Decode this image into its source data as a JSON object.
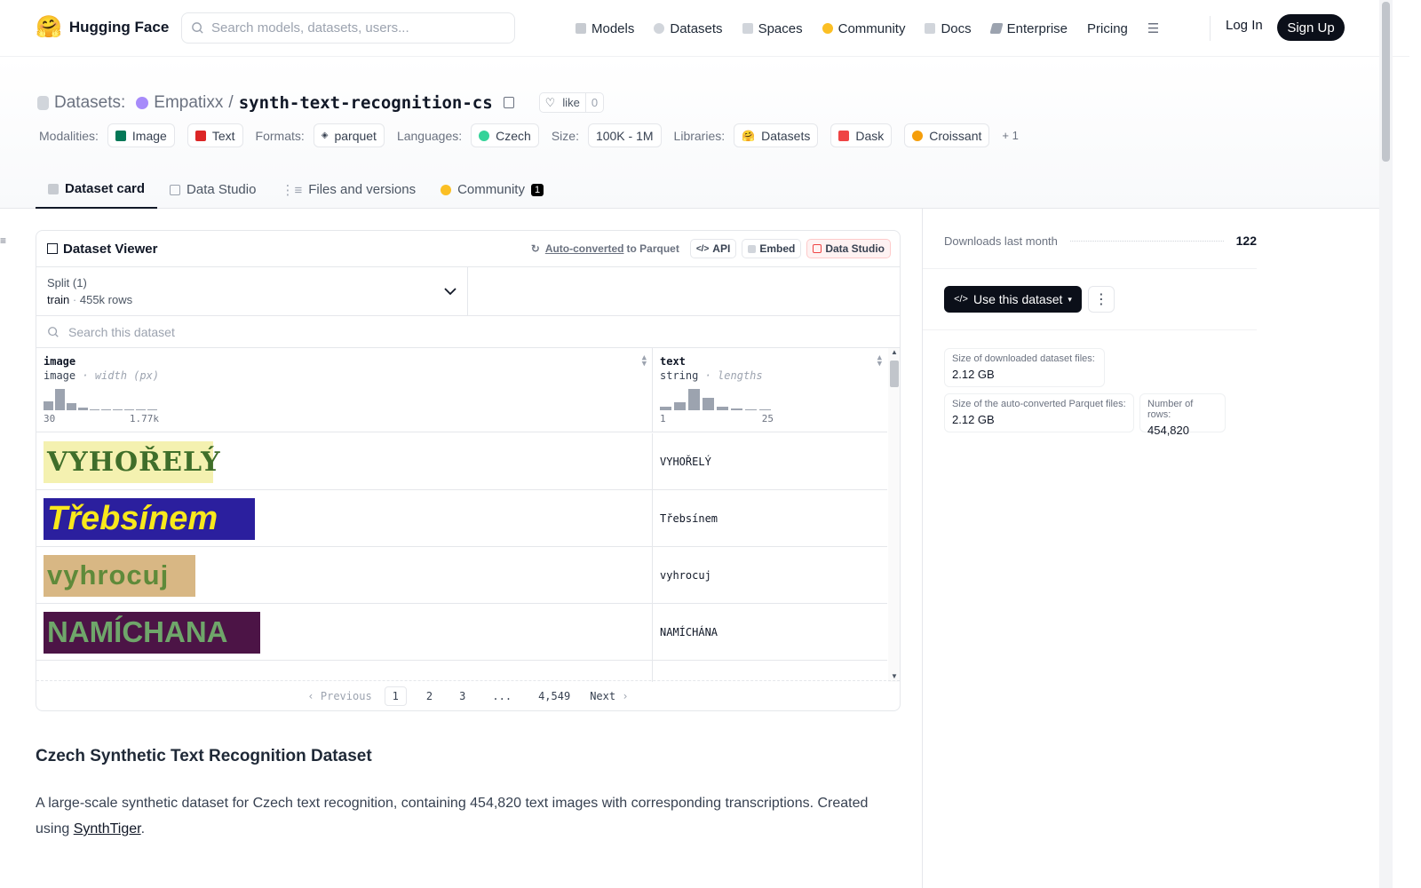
{
  "nav": {
    "brand": "Hugging Face",
    "search_placeholder": "Search models, datasets, users...",
    "links": [
      "Models",
      "Datasets",
      "Spaces",
      "Community",
      "Docs",
      "Enterprise",
      "Pricing"
    ],
    "login": "Log In",
    "signup": "Sign Up"
  },
  "header": {
    "kind": "Datasets:",
    "owner": "Empatixx",
    "sep": "/",
    "name": "synth-text-recognition-cs",
    "like": "like",
    "likes": "0",
    "modalities_label": "Modalities:",
    "modalities": [
      "Image",
      "Text"
    ],
    "formats_label": "Formats:",
    "format": "parquet",
    "languages_label": "Languages:",
    "language": "Czech",
    "size_label": "Size:",
    "size": "100K - 1M",
    "libraries_label": "Libraries:",
    "libraries": [
      "Datasets",
      "Dask",
      "Croissant"
    ],
    "more_libs": "+ 1"
  },
  "tabs": [
    "Dataset card",
    "Data Studio",
    "Files and versions",
    "Community"
  ],
  "community_count": "1",
  "viewer": {
    "title": "Dataset Viewer",
    "autoconv": "Auto-converted",
    "to": "to Parquet",
    "api": "API",
    "embed": "Embed",
    "studio": "Data Studio",
    "split_label": "Split (1)",
    "split": "train",
    "rows": "455k rows",
    "search": "Search this dataset",
    "col1": {
      "name": "image",
      "type": "image",
      "stat": "width (px)",
      "min": "30",
      "max": "1.77k"
    },
    "col2": {
      "name": "text",
      "type": "string",
      "stat": "lengths",
      "min": "1",
      "max": "25"
    },
    "records": [
      {
        "img": "VYHOŘELÝ",
        "text": "VYHOŘELÝ"
      },
      {
        "img": "Třebsínem",
        "text": "Třebsínem"
      },
      {
        "img": "vyhrocuj",
        "text": "vyhrocuj"
      },
      {
        "img": "NAMÍCHANA",
        "text": "NAMÍCHÁNA"
      }
    ],
    "pager": {
      "prev": "Previous",
      "pages": [
        "1",
        "2",
        "3",
        "...",
        "4,549"
      ],
      "next": "Next"
    }
  },
  "side": {
    "downloads_label": "Downloads last month",
    "downloads": "122",
    "use": "Use this dataset",
    "dl_size_label": "Size of downloaded dataset files:",
    "dl_size": "2.12 GB",
    "pq_size_label": "Size of the auto-converted Parquet files:",
    "pq_size": "2.12 GB",
    "rows_label": "Number of rows:",
    "rows": "454,820"
  },
  "card": {
    "heading": "Czech Synthetic Text Recognition Dataset",
    "para_pre": "A large-scale synthetic dataset for Czech text recognition, containing 454,820 text images with corresponding transcriptions. Created using ",
    "link": "SynthTiger",
    "para_post": "."
  }
}
